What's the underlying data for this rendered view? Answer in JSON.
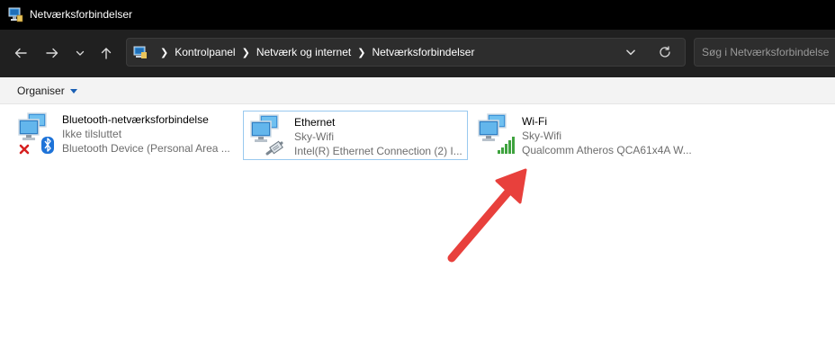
{
  "window": {
    "title": "Netværksforbindelser"
  },
  "navigation": {
    "back_icon": "arrow-left-icon",
    "forward_icon": "arrow-right-icon",
    "recent_icon": "chevron-down-icon",
    "up_icon": "arrow-up-icon"
  },
  "address_bar": {
    "breadcrumbs": [
      "Kontrolpanel",
      "Netværk og internet",
      "Netværksforbindelser"
    ],
    "refresh_icon": "refresh-icon"
  },
  "search": {
    "placeholder": "Søg i Netværksforbindelser"
  },
  "command_bar": {
    "organise_label": "Organiser"
  },
  "connections": [
    {
      "name": "Bluetooth-netværksforbindelse",
      "status": "Ikke tilsluttet",
      "device": "Bluetooth Device (Personal Area ...",
      "icon": "bluetooth-network-icon",
      "selected": false
    },
    {
      "name": "Ethernet",
      "status": "Sky-Wifi",
      "device": "Intel(R) Ethernet Connection (2) I...",
      "icon": "ethernet-network-icon",
      "selected": true
    },
    {
      "name": "Wi-Fi",
      "status": "Sky-Wifi",
      "device": "Qualcomm Atheros QCA61x4A W...",
      "icon": "wifi-network-icon",
      "selected": false
    }
  ],
  "annotation": {
    "icon": "red-arrow-pointing-to-wifi",
    "color": "#e8403c"
  },
  "colors": {
    "titlebar": "#000000",
    "navbar": "#202020",
    "selection_border": "#99c9ef",
    "wifi_signal": "#3fa33f"
  }
}
